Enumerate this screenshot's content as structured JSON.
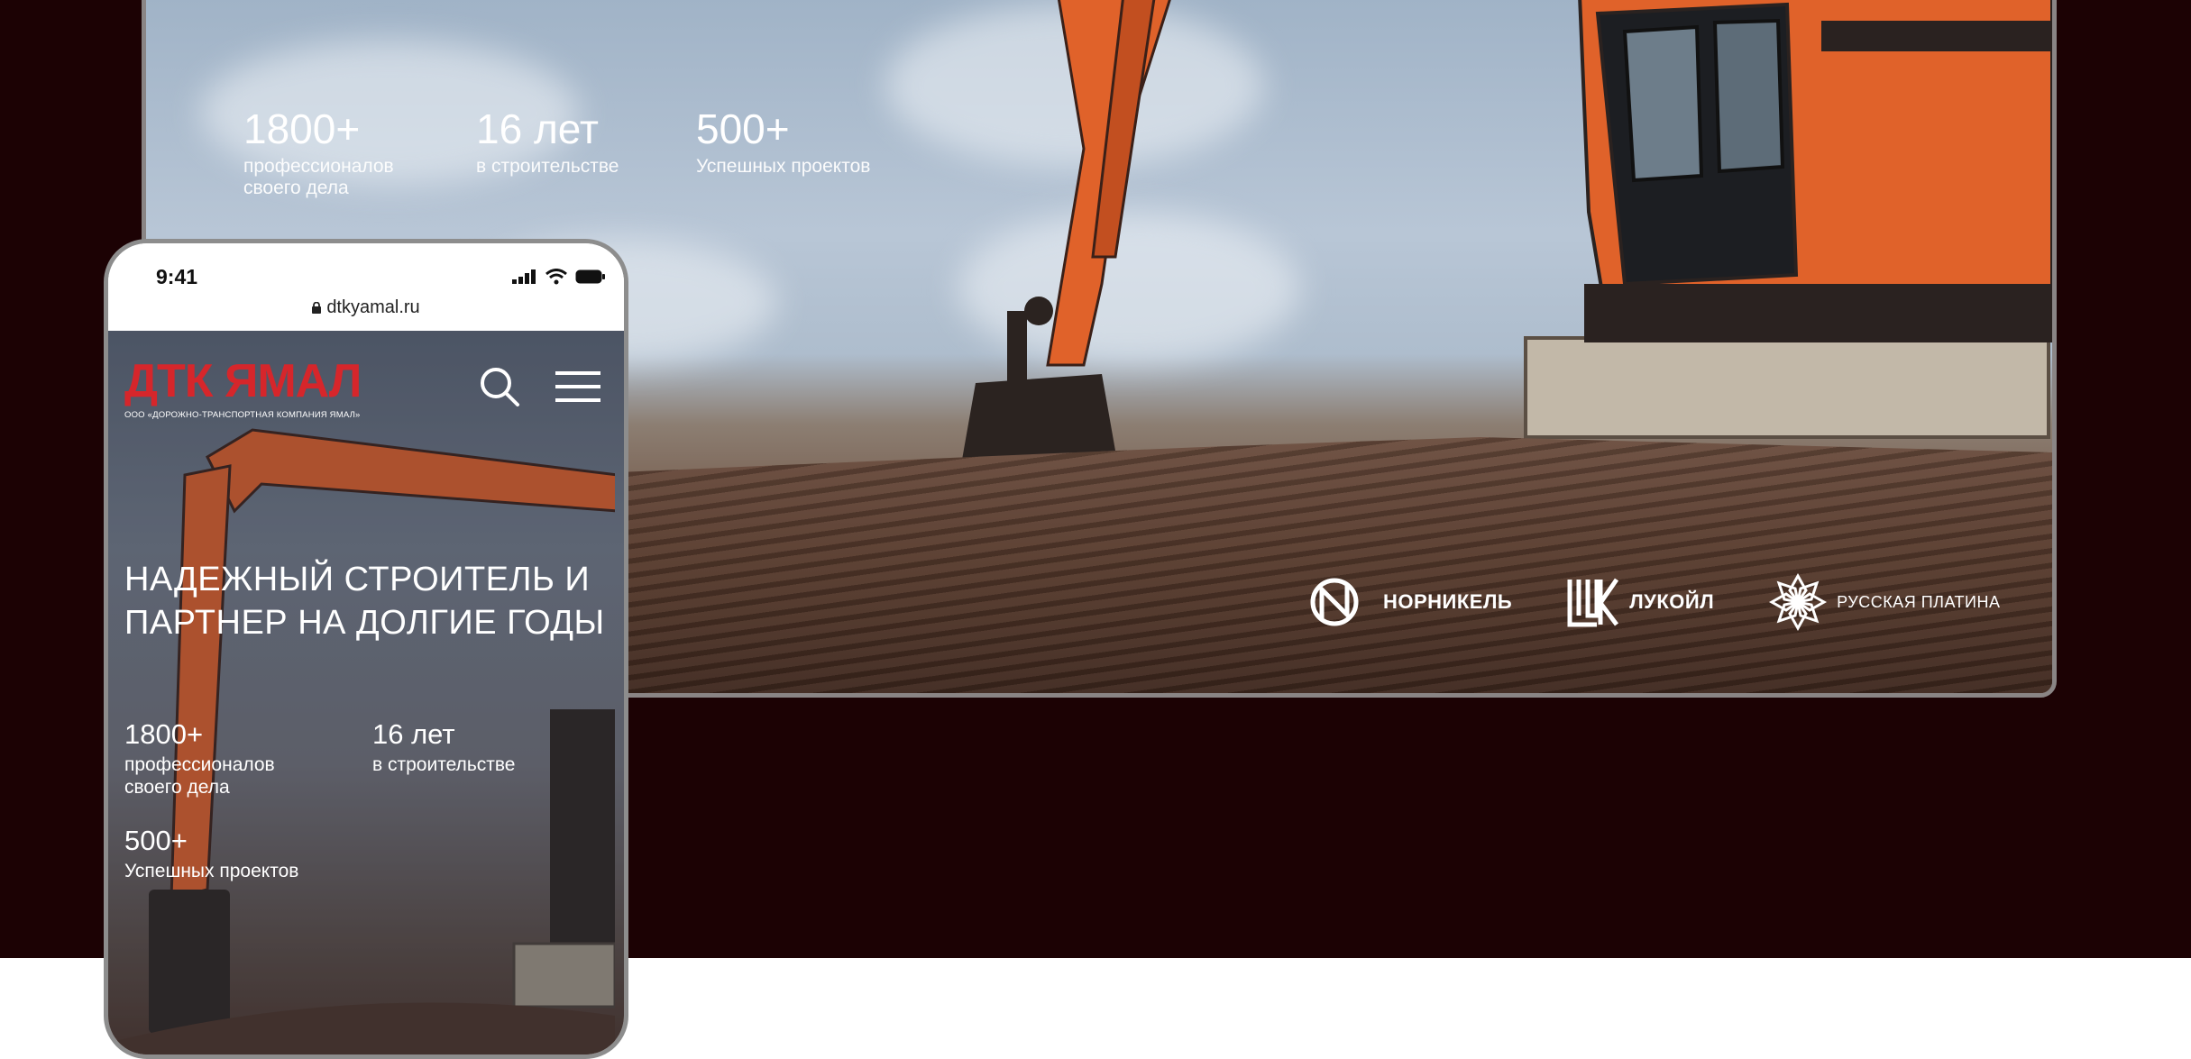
{
  "desktop": {
    "stats": [
      {
        "value": "1800+",
        "label_line1": "профессионалов",
        "label_line2": "своего дела"
      },
      {
        "value": "16 лет",
        "label_line1": "в строительстве",
        "label_line2": ""
      },
      {
        "value": "500+",
        "label_line1": "Успешных  проектов",
        "label_line2": ""
      }
    ],
    "partners": [
      {
        "name": "НОРНИКЕЛЬ",
        "icon": "nornickel-logo-icon"
      },
      {
        "name": "ЛУКОЙЛ",
        "icon": "lukoil-logo-icon"
      },
      {
        "name": "РУССКАЯ ПЛАТИНА",
        "icon": "russian-platinum-logo-icon"
      }
    ]
  },
  "phone": {
    "time": "9:41",
    "url": "dtkyamal.ru",
    "brand": "ДТК ЯМАЛ",
    "brand_sub": "ООО «ДОРОЖНО-ТРАНСПОРТНАЯ КОМПАНИЯ ЯМАЛ»",
    "hero_line1": "НАДЕЖНЫЙ СТРОИТЕЛЬ И",
    "hero_line2": "ПАРТНЕР НА ДОЛГИЕ ГОДЫ",
    "stats": [
      {
        "value": "1800+",
        "label_line1": "профессионалов",
        "label_line2": "своего дела"
      },
      {
        "value": "16 лет",
        "label_line1": "в строительстве",
        "label_line2": ""
      },
      {
        "value": "500+",
        "label_line1": "Успешных  проектов",
        "label_line2": ""
      }
    ]
  },
  "colors": {
    "background": "#1c0204",
    "brand_red": "#d6262b",
    "excavator_orange": "#e0622a"
  }
}
